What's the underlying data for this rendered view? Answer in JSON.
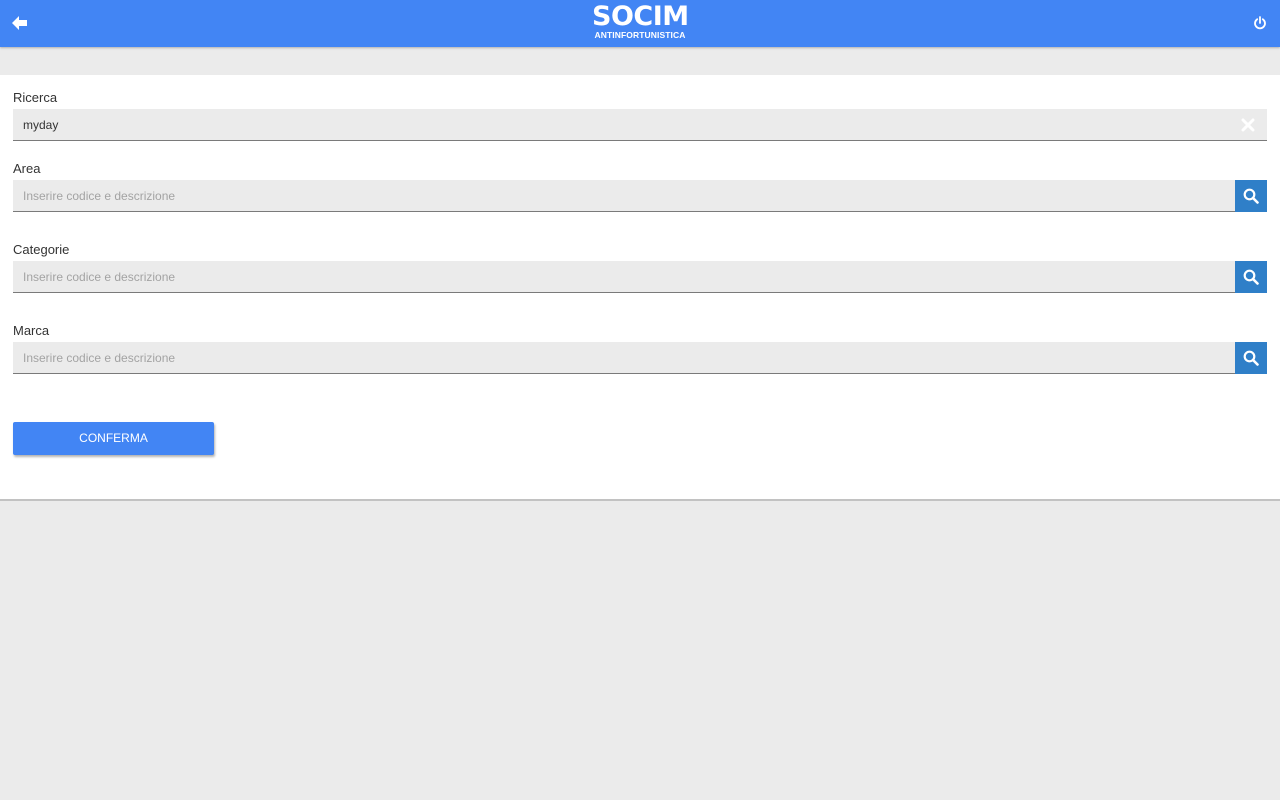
{
  "header": {
    "logo_main": "SOCIM",
    "logo_sub": "ANTINFORTUNISTICA",
    "back_icon": "arrow-left-icon",
    "power_icon": "power-icon",
    "bg_color": "#4285f4"
  },
  "form": {
    "ricerca": {
      "label": "Ricerca",
      "value": "myday",
      "clear_icon": "close-icon"
    },
    "area": {
      "label": "Area",
      "placeholder": "Inserire codice e descrizione",
      "value": "",
      "search_icon": "search-icon"
    },
    "categorie": {
      "label": "Categorie",
      "placeholder": "Inserire codice e descrizione",
      "value": "",
      "search_icon": "search-icon"
    },
    "marca": {
      "label": "Marca",
      "placeholder": "Inserire codice e descrizione",
      "value": "",
      "search_icon": "search-icon"
    },
    "confirm_label": "CONFERMA",
    "button_color": "#4285f4",
    "search_button_color": "#2f7fc8"
  }
}
